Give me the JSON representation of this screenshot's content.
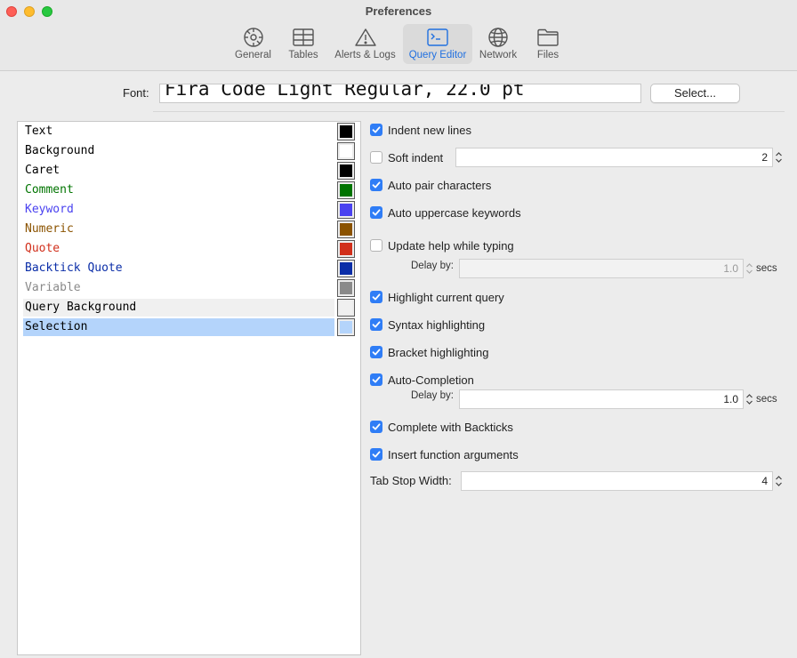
{
  "window": {
    "title": "Preferences"
  },
  "tabs": [
    {
      "label": "General",
      "icon": "gear-icon"
    },
    {
      "label": "Tables",
      "icon": "table-icon"
    },
    {
      "label": "Alerts & Logs",
      "icon": "warning-icon"
    },
    {
      "label": "Query Editor",
      "icon": "terminal-icon",
      "active": true
    },
    {
      "label": "Network",
      "icon": "globe-icon"
    },
    {
      "label": "Files",
      "icon": "folder-icon"
    }
  ],
  "font": {
    "label": "Font:",
    "value": "Fira Code Light Regular, 22.0 pt",
    "select_label": "Select..."
  },
  "colors": [
    {
      "name": "Text",
      "color": "#000000"
    },
    {
      "name": "Background",
      "color": "#ffffff"
    },
    {
      "name": "Caret",
      "color": "#000000"
    },
    {
      "name": "Comment",
      "color": "#007400"
    },
    {
      "name": "Keyword",
      "color": "#4a42f0"
    },
    {
      "name": "Numeric",
      "color": "#8b5300"
    },
    {
      "name": "Quote",
      "color": "#d12f1b"
    },
    {
      "name": "Backtick Quote",
      "color": "#0b2ea8"
    },
    {
      "name": "Variable",
      "color": "#8a8a8a"
    },
    {
      "name": "Query Background",
      "color": "#f0f0f0"
    },
    {
      "name": "Selection",
      "color": "#b4d4fb"
    }
  ],
  "options": {
    "indent_new_lines": {
      "label": "Indent new lines",
      "checked": true
    },
    "soft_indent": {
      "label": "Soft indent",
      "checked": false,
      "value": "2"
    },
    "auto_pair": {
      "label": "Auto pair characters",
      "checked": true
    },
    "auto_uppercase": {
      "label": "Auto uppercase keywords",
      "checked": true
    },
    "update_help": {
      "label": "Update help while typing",
      "checked": false,
      "delay_label": "Delay by:",
      "delay_value": "1.0",
      "unit": "secs"
    },
    "highlight_query": {
      "label": "Highlight current query",
      "checked": true
    },
    "syntax_highlighting": {
      "label": "Syntax highlighting",
      "checked": true
    },
    "bracket_highlighting": {
      "label": "Bracket highlighting",
      "checked": true
    },
    "auto_completion": {
      "label": "Auto-Completion",
      "checked": true,
      "delay_label": "Delay by:",
      "delay_value": "1.0",
      "unit": "secs"
    },
    "complete_backticks": {
      "label": "Complete with Backticks",
      "checked": true
    },
    "insert_function_args": {
      "label": "Insert function arguments",
      "checked": true
    },
    "tab_stop": {
      "label": "Tab Stop Width:",
      "value": "4"
    }
  },
  "accent_color": "#2f7df6"
}
